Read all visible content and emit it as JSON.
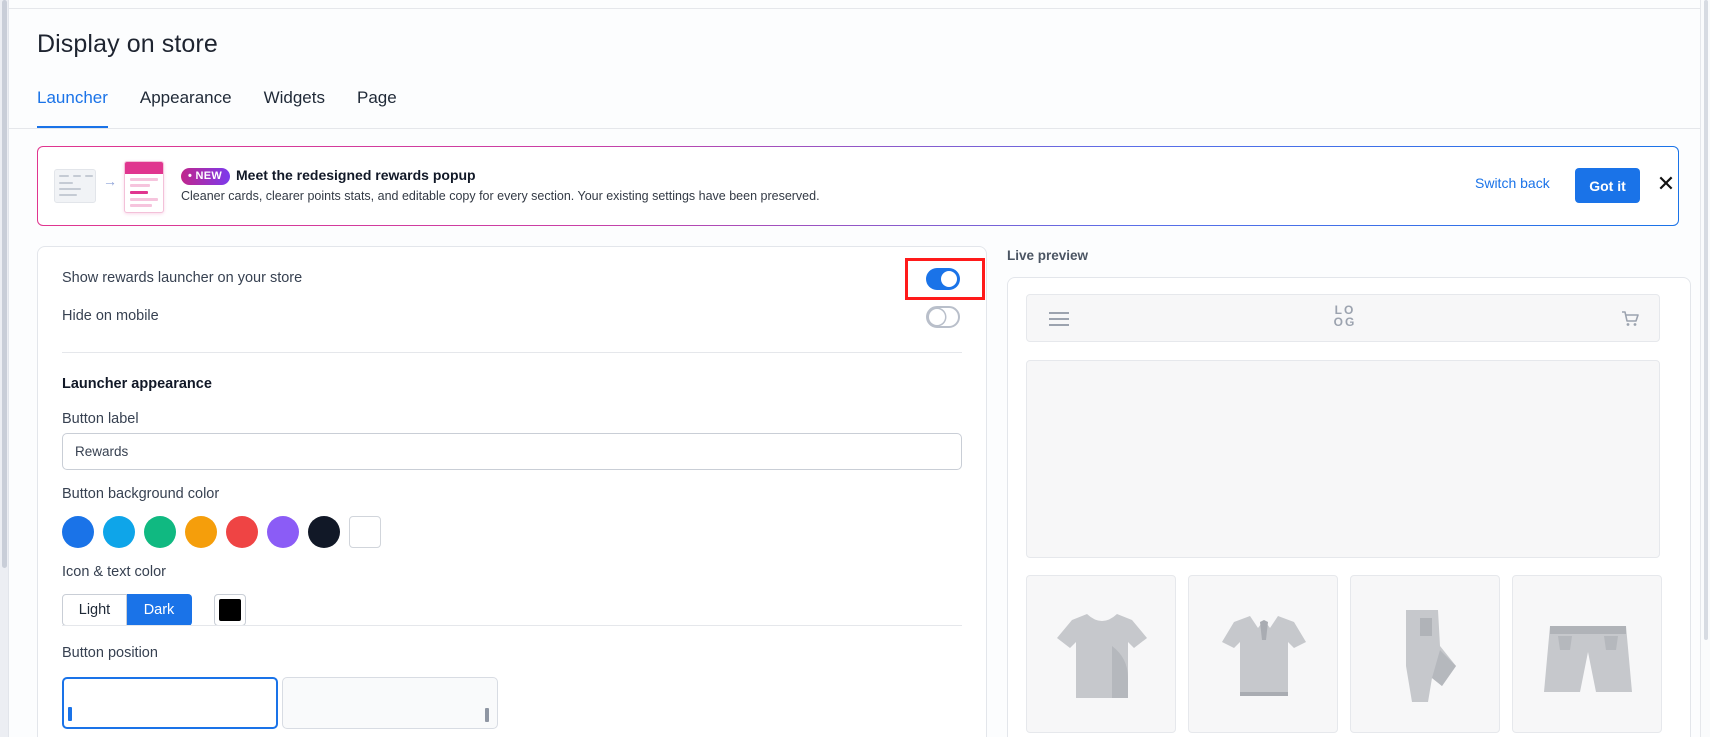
{
  "page": {
    "title": "Display on store"
  },
  "tabs": [
    {
      "label": "Launcher",
      "active": true
    },
    {
      "label": "Appearance",
      "active": false
    },
    {
      "label": "Widgets",
      "active": false
    },
    {
      "label": "Page",
      "active": false
    }
  ],
  "banner": {
    "badge": "NEW",
    "title": "Meet the redesigned rewards popup",
    "description": "Cleaner cards, clearer points stats, and editable copy for every section. Your existing settings have been preserved.",
    "switch_back_label": "Switch back",
    "got_it_label": "Got it",
    "close_glyph": "✕"
  },
  "settings": {
    "show_launcher": {
      "label": "Show rewards launcher on your store",
      "enabled": true
    },
    "hide_on_mobile": {
      "label": "Hide on mobile",
      "enabled": false
    },
    "launcher_appearance_title": "Launcher appearance",
    "button_label": {
      "label": "Button label",
      "value": "Rewards"
    },
    "button_background_color": {
      "label": "Button background color",
      "swatches": [
        "#1a73e8",
        "#0ea5e9",
        "#10b981",
        "#f59e0b",
        "#ef4444",
        "#8b5cf6",
        "#111827",
        "#ffffff"
      ]
    },
    "icon_text_color": {
      "label": "Icon & text color",
      "options": [
        "Light",
        "Dark"
      ],
      "selected": "Dark",
      "custom_color": "#000000"
    },
    "button_position": {
      "label": "Button position",
      "selected": "left"
    }
  },
  "preview": {
    "label": "Live preview",
    "logo_line1": "LO",
    "logo_line2": "OG",
    "products": [
      "t-shirt-icon",
      "polo-shirt-icon",
      "jeans-icon",
      "shorts-icon"
    ]
  },
  "colors": {
    "accent": "#1a73e8",
    "highlight": "#ff1a1a"
  }
}
